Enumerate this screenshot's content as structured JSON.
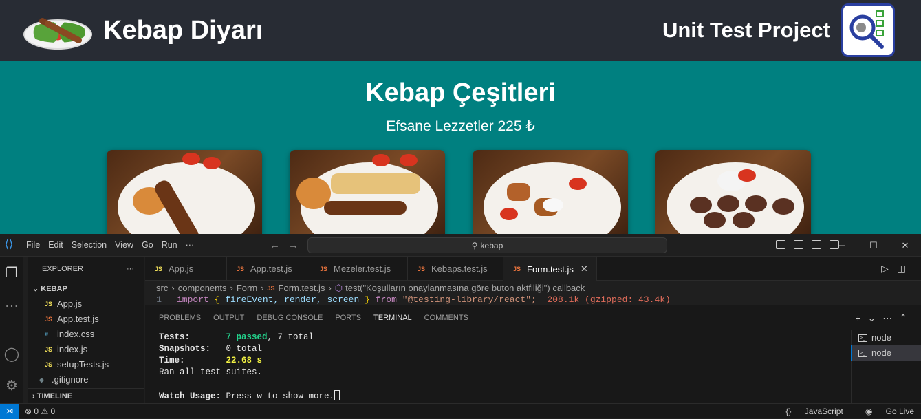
{
  "app": {
    "brand_title": "Kebap Diyarı",
    "project_title": "Unit Test Project",
    "heading": "Kebap Çeşitleri",
    "subtitle": "Efsane Lezzetler 225 ₺",
    "cards": [
      "kebap-image-1",
      "kebap-image-2",
      "kebap-image-3",
      "kebap-image-4"
    ]
  },
  "vscode": {
    "menu": [
      "File",
      "Edit",
      "Selection",
      "View",
      "Go",
      "Run",
      "···"
    ],
    "search": "kebap",
    "explorer": {
      "title": "EXPLORER",
      "more": "···",
      "folder": "KEBAP",
      "files": [
        {
          "icon": "JS",
          "name": "App.js",
          "color": "#f1e05a"
        },
        {
          "icon": "JS",
          "name": "App.test.js",
          "color": "#e8733d"
        },
        {
          "icon": "#",
          "name": "index.css",
          "color": "#519aba"
        },
        {
          "icon": "JS",
          "name": "index.js",
          "color": "#f1e05a"
        },
        {
          "icon": "JS",
          "name": "setupTests.js",
          "color": "#f1e05a"
        },
        {
          "icon": "◆",
          "name": ".gitignore",
          "color": "#6d8086"
        }
      ],
      "timeline": "TIMELINE"
    },
    "tabs": [
      {
        "icon": "JS",
        "name": "App.js",
        "color": "#f1e05a"
      },
      {
        "icon": "JS",
        "name": "App.test.js",
        "color": "#e8733d"
      },
      {
        "icon": "JS",
        "name": "Mezeler.test.js",
        "color": "#e8733d"
      },
      {
        "icon": "JS",
        "name": "Kebaps.test.js",
        "color": "#e8733d"
      },
      {
        "icon": "JS",
        "name": "Form.test.js",
        "color": "#e8733d",
        "close": "✕"
      }
    ],
    "breadcrumb": {
      "src": "src",
      "components": "components",
      "form": "Form",
      "file": "Form.test.js",
      "symbol": "test(\"Koşulların onaylanmasına göre buton aktfiliği\") callback"
    },
    "code": {
      "line_no": "1",
      "import_kw": "import",
      "braces_open": "{",
      "names": "fireEvent, render, screen",
      "braces_close": "}",
      "from_kw": "from",
      "module": "\"@testing-library/react\";",
      "size_hint": "208.1k (gzipped: 43.4k)"
    },
    "panel_tabs": [
      "PROBLEMS",
      "OUTPUT",
      "DEBUG CONSOLE",
      "PORTS",
      "TERMINAL",
      "COMMENTS"
    ],
    "terminal": {
      "tests_label": "Tests:",
      "tests_passed": "7 passed",
      "tests_total": ", 7 total",
      "snapshots_label": "Snapshots:",
      "snapshots_value": "0 total",
      "time_label": "Time:",
      "time_value": "22.68 s",
      "ran": "Ran all test suites.",
      "watch_label": "Watch Usage:",
      "watch_text": "Press w to show more."
    },
    "terminals": [
      "node",
      "node"
    ],
    "status": {
      "errors": "0",
      "warnings": "0",
      "language": "JavaScript",
      "live": "Go Live"
    }
  }
}
